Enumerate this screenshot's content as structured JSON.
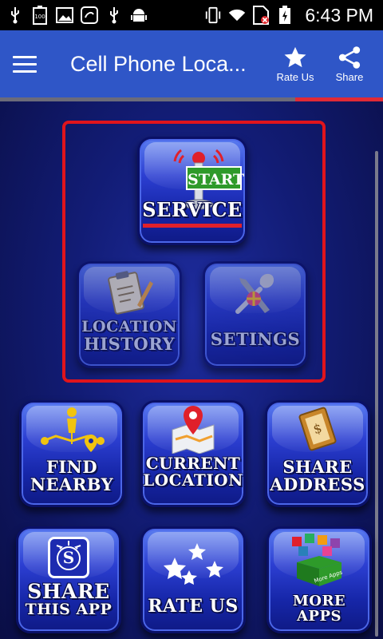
{
  "status_bar": {
    "time": "6:43 PM"
  },
  "app_bar": {
    "title": "Cell Phone Loca...",
    "actions": [
      {
        "label": "Rate Us",
        "icon": "star-icon"
      },
      {
        "label": "Share",
        "icon": "share-icon"
      }
    ]
  },
  "tiles": {
    "start_service": {
      "badge": "START",
      "label": "SERVICE"
    },
    "location_history": {
      "line1": "LOCATION",
      "line2": "HISTORY"
    },
    "settings": {
      "label": "SETINGS"
    },
    "find_nearby": {
      "line1": "FIND",
      "line2": "NEARBY"
    },
    "current_location": {
      "line1": "CURRENT",
      "line2": "LOCATION"
    },
    "share_address": {
      "line1": "SHARE",
      "line2": "ADDRESS"
    },
    "share_app": {
      "line1": "SHARE",
      "line2": "THIS APP",
      "icon_letter": "S"
    },
    "rate_us": {
      "label": "RATE US"
    },
    "more_apps": {
      "label": "MORE APPS",
      "box_text": "More Apps"
    }
  },
  "colors": {
    "app_bar": "#2f56c7",
    "highlight_border": "#e0141c",
    "start_badge": "#2e9a2a"
  }
}
